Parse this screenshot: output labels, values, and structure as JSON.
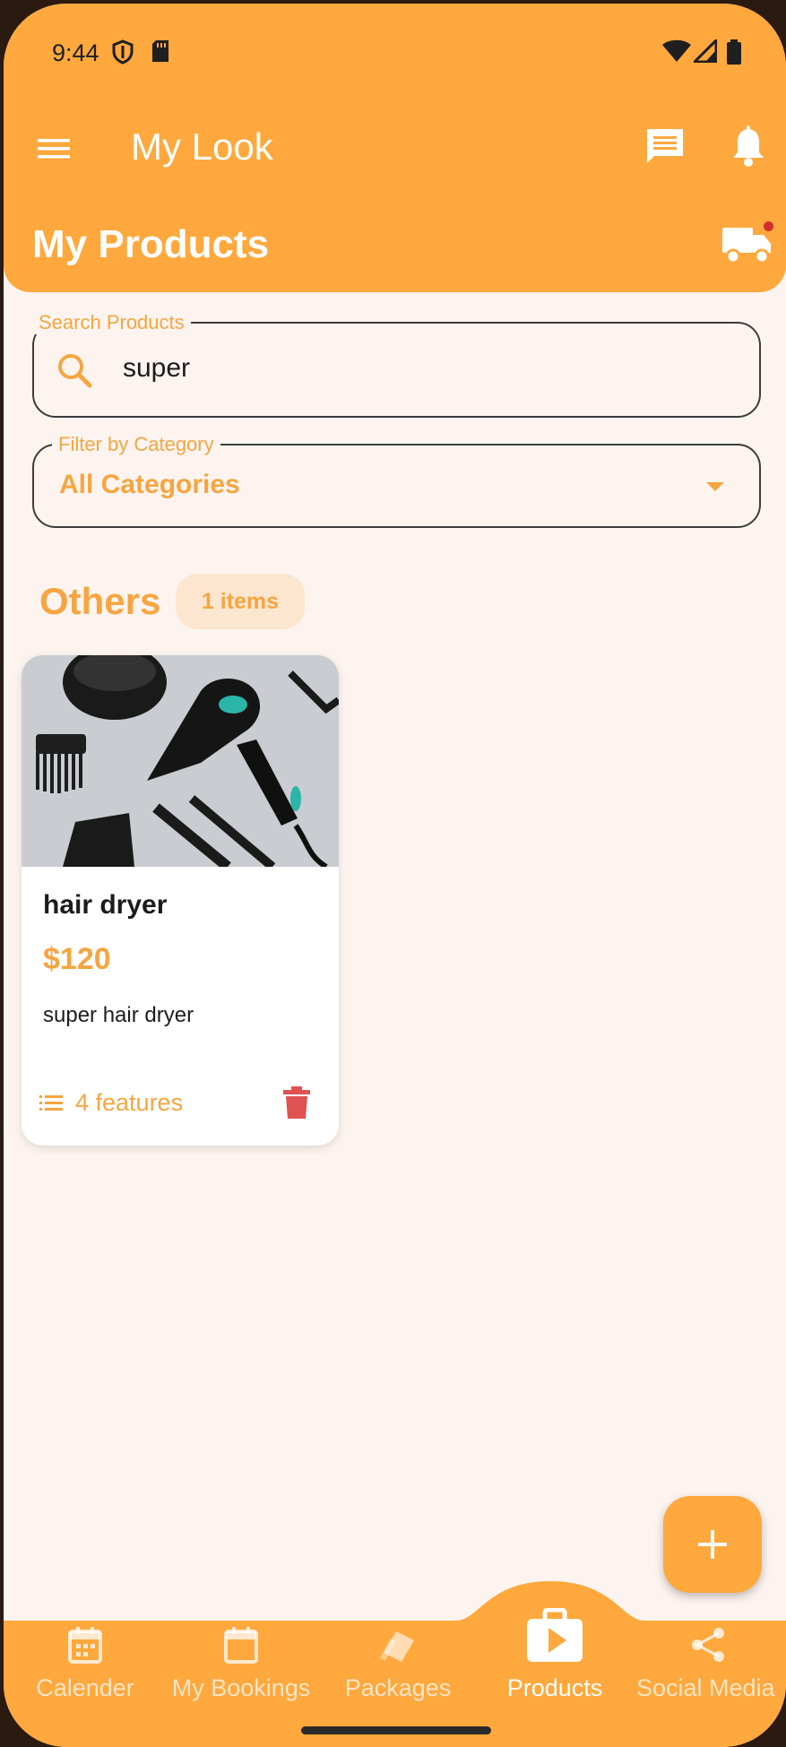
{
  "status_bar": {
    "time": "9:44"
  },
  "app_bar": {
    "title": "My Look",
    "page_title": "My Products"
  },
  "search": {
    "label": "Search Products",
    "value": "super"
  },
  "filter": {
    "label": "Filter by Category",
    "value": "All Categories"
  },
  "section": {
    "title": "Others",
    "count": "1 items"
  },
  "products": [
    {
      "name": "hair dryer",
      "price": "$120",
      "description": "super hair dryer",
      "features": "4 features"
    }
  ],
  "bottom_nav": {
    "items": [
      {
        "label": "Calender",
        "icon": "calendar-icon"
      },
      {
        "label": "My Bookings",
        "icon": "calendar-blank-icon"
      },
      {
        "label": "Packages",
        "icon": "packages-icon"
      },
      {
        "label": "Products",
        "icon": "shopping-bag-play-icon",
        "active": true
      },
      {
        "label": "Social Media",
        "icon": "share-icon"
      }
    ]
  },
  "colors": {
    "primary": "#FFA83D",
    "accent_text": "#F7A540",
    "background": "#FDF4F0",
    "delete": "#E05252"
  }
}
